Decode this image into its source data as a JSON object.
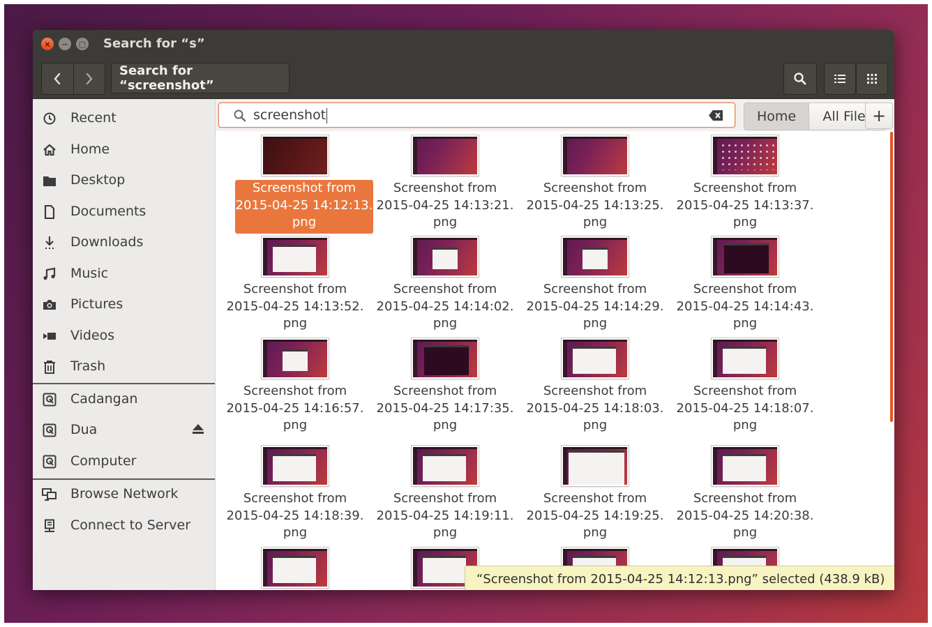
{
  "window": {
    "title": "Search for “s”",
    "controls": {
      "close": "×",
      "minimize": "−",
      "maximize": "□"
    }
  },
  "header": {
    "path_label": "Search for “screenshot”",
    "icons": [
      "back-arrow-icon",
      "forward-arrow-icon",
      "search-icon",
      "list-view-icon",
      "grid-view-icon"
    ]
  },
  "sidebar": {
    "places": [
      {
        "label": "Recent",
        "icon": "clock-icon"
      },
      {
        "label": "Home",
        "icon": "home-icon"
      },
      {
        "label": "Desktop",
        "icon": "folder-icon"
      },
      {
        "label": "Documents",
        "icon": "document-icon"
      },
      {
        "label": "Downloads",
        "icon": "download-icon"
      },
      {
        "label": "Music",
        "icon": "music-icon"
      },
      {
        "label": "Pictures",
        "icon": "camera-icon"
      },
      {
        "label": "Videos",
        "icon": "video-icon"
      },
      {
        "label": "Trash",
        "icon": "trash-icon"
      }
    ],
    "devices": [
      {
        "label": "Cadangan",
        "icon": "drive-icon"
      },
      {
        "label": "Dua",
        "icon": "drive-icon",
        "eject": true
      },
      {
        "label": "Computer",
        "icon": "drive-icon"
      }
    ],
    "network": [
      {
        "label": "Browse Network",
        "icon": "network-icon"
      },
      {
        "label": "Connect to Server",
        "icon": "server-icon"
      }
    ]
  },
  "search": {
    "query": "screenshot",
    "scope_buttons": [
      "Home",
      "All Files"
    ],
    "active_scope": "Home",
    "add_label": "+"
  },
  "files": [
    {
      "line1": "Screenshot from",
      "line2": "2015-04-25 14:12:13.",
      "line3": "png",
      "selected": true,
      "thumb": "dark"
    },
    {
      "line1": "Screenshot from",
      "line2": "2015-04-25 14:13:21.",
      "line3": "png",
      "thumb": "desktop"
    },
    {
      "line1": "Screenshot from",
      "line2": "2015-04-25 14:13:25.",
      "line3": "png",
      "thumb": "desktop"
    },
    {
      "line1": "Screenshot from",
      "line2": "2015-04-25 14:13:37.",
      "line3": "png",
      "thumb": "dash"
    },
    {
      "line1": "Screenshot from",
      "line2": "2015-04-25 14:13:52.",
      "line3": "png",
      "thumb": "window"
    },
    {
      "line1": "Screenshot from",
      "line2": "2015-04-25 14:14:02.",
      "line3": "png",
      "thumb": "dialog"
    },
    {
      "line1": "Screenshot from",
      "line2": "2015-04-25 14:14:29.",
      "line3": "png",
      "thumb": "dialog"
    },
    {
      "line1": "Screenshot from",
      "line2": "2015-04-25 14:14:43.",
      "line3": "png",
      "thumb": "terminal"
    },
    {
      "line1": "Screenshot from",
      "line2": "2015-04-25 14:16:57.",
      "line3": "png",
      "thumb": "dialog"
    },
    {
      "line1": "Screenshot from",
      "line2": "2015-04-25 14:17:35.",
      "line3": "png",
      "thumb": "terminal"
    },
    {
      "line1": "Screenshot from",
      "line2": "2015-04-25 14:18:03.",
      "line3": "png",
      "thumb": "window"
    },
    {
      "line1": "Screenshot from",
      "line2": "2015-04-25 14:18:07.",
      "line3": "png",
      "thumb": "window"
    },
    {
      "line1": "Screenshot from",
      "line2": "2015-04-25 14:18:39.",
      "line3": "png",
      "thumb": "window"
    },
    {
      "line1": "Screenshot from",
      "line2": "2015-04-25 14:19:11.",
      "line3": "png",
      "thumb": "window"
    },
    {
      "line1": "Screenshot from",
      "line2": "2015-04-25 14:19:25.",
      "line3": "png",
      "thumb": "bigwindow"
    },
    {
      "line1": "Screenshot from",
      "line2": "2015-04-25 14:20:38.",
      "line3": "png",
      "thumb": "window"
    },
    {
      "line1": "",
      "line2": "",
      "line3": "",
      "thumb": "window"
    },
    {
      "line1": "",
      "line2": "",
      "line3": "",
      "thumb": "window"
    },
    {
      "line1": "",
      "line2": "",
      "line3": "",
      "thumb": "window"
    },
    {
      "line1": "",
      "line2": "",
      "line3": "",
      "thumb": "window"
    }
  ],
  "status": {
    "text": "“Screenshot from 2015-04-25 14:12:13.png” selected  (438.9 kB)"
  },
  "colors": {
    "accent": "#e95420",
    "selection": "#e9773d",
    "titlebar": "#3c3b37",
    "sidebar": "#ecebe9",
    "status_bg": "#f8f4c2"
  }
}
